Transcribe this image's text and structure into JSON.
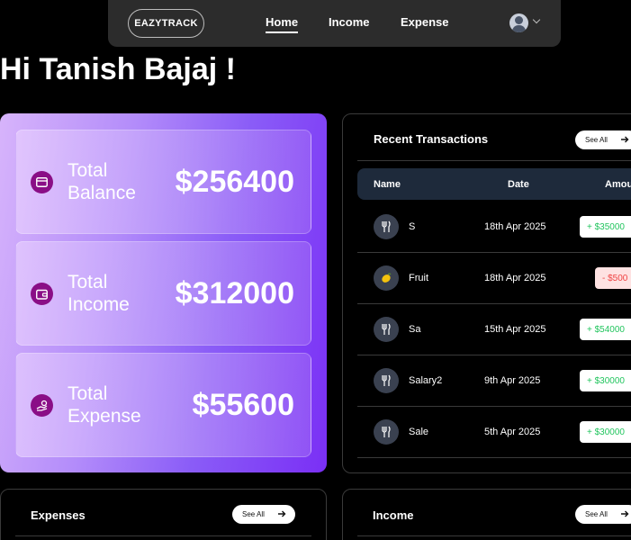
{
  "nav": {
    "logo": "EAZYTRACK",
    "links": [
      "Home",
      "Income",
      "Expense"
    ],
    "active": "Home"
  },
  "greeting": "Hi Tanish Bajaj !",
  "summary": [
    {
      "label": "Total Balance",
      "amount": "$256400",
      "icon": "credit-card-icon"
    },
    {
      "label": "Total Income",
      "amount": "$312000",
      "icon": "wallet-icon"
    },
    {
      "label": "Total Expense",
      "amount": "$55600",
      "icon": "hand-coins-icon"
    }
  ],
  "transactions": {
    "title": "Recent Transactions",
    "see_all": "See All",
    "columns": [
      "Name",
      "Date",
      "Amount"
    ],
    "rows": [
      {
        "name": "S",
        "date": "18th Apr 2025",
        "amount": "+ $35000",
        "type": "income",
        "icon": "utensils-icon"
      },
      {
        "name": "Fruit",
        "date": "18th Apr 2025",
        "amount": "- $500",
        "type": "expense",
        "icon": "lemon-icon"
      },
      {
        "name": "Sa",
        "date": "15th Apr 2025",
        "amount": "+ $54000",
        "type": "income",
        "icon": "utensils-icon"
      },
      {
        "name": "Salary2",
        "date": "9th Apr 2025",
        "amount": "+ $30000",
        "type": "income",
        "icon": "utensils-icon"
      },
      {
        "name": "Sale",
        "date": "5th Apr 2025",
        "amount": "+ $30000",
        "type": "income",
        "icon": "utensils-icon"
      }
    ]
  },
  "expenses_panel": {
    "title": "Expenses",
    "see_all": "See All"
  },
  "income_panel": {
    "title": "Income",
    "see_all": "See All"
  },
  "colors": {
    "background": "#000000",
    "icon_purple": "#8a0e86",
    "positive": "#22c55e",
    "negative": "#ef4444",
    "table_header": "#1e2a3b"
  }
}
